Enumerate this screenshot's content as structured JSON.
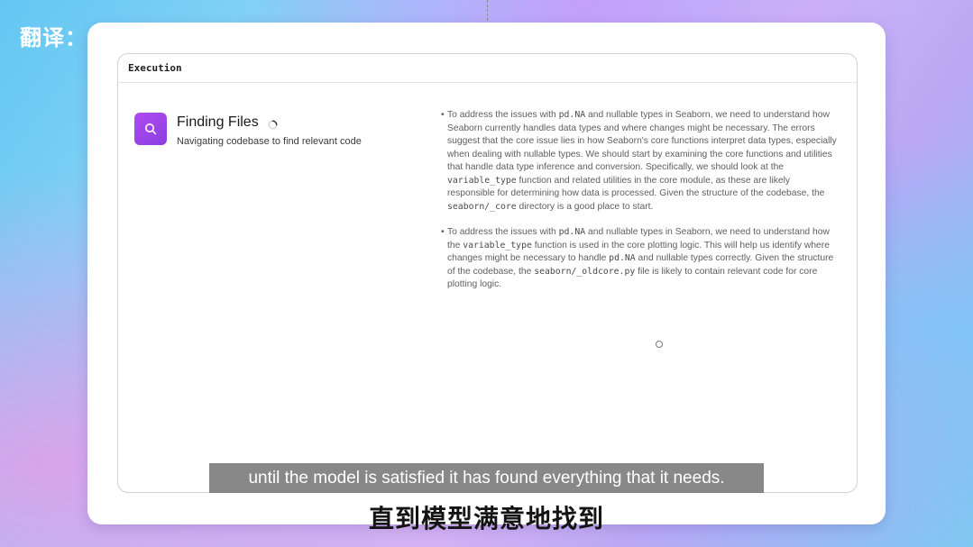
{
  "watermark": "翻译：",
  "panel": {
    "title": "Execution"
  },
  "step": {
    "icon": "search-icon",
    "title": "Finding Files",
    "status_icon": "loading-spinner-icon",
    "subtitle": "Navigating codebase to find relevant code"
  },
  "log": {
    "entries": [
      {
        "segments": [
          {
            "text": "To address the issues with ",
            "code": false
          },
          {
            "text": "pd.NA",
            "code": true
          },
          {
            "text": " and nullable types in Seaborn, we need to understand how Seaborn currently handles data types and where changes might be necessary. The errors suggest that the core issue lies in how Seaborn's core functions interpret data types, especially when dealing with nullable types. We should start by examining the core functions and utilities that handle data type inference and conversion. Specifically, we should look at the ",
            "code": false
          },
          {
            "text": "variable_type",
            "code": true
          },
          {
            "text": " function and related utilities in the core module, as these are likely responsible for determining how data is processed. Given the structure of the codebase, the ",
            "code": false
          },
          {
            "text": "seaborn/_core",
            "code": true
          },
          {
            "text": " directory is a good place to start.",
            "code": false
          }
        ]
      },
      {
        "segments": [
          {
            "text": "To address the issues with ",
            "code": false
          },
          {
            "text": "pd.NA",
            "code": true
          },
          {
            "text": " and nullable types in Seaborn, we need to understand how the ",
            "code": false
          },
          {
            "text": "variable_type",
            "code": true
          },
          {
            "text": " function is used in the core plotting logic. This will help us identify where changes might be necessary to handle ",
            "code": false
          },
          {
            "text": "pd.NA",
            "code": true
          },
          {
            "text": " and nullable types correctly. Given the structure of the codebase, the ",
            "code": false
          },
          {
            "text": "seaborn/_oldcore.py",
            "code": true
          },
          {
            "text": " file is likely to contain relevant code for core plotting logic.",
            "code": false
          }
        ]
      }
    ]
  },
  "captions": {
    "english": "until the model is satisfied it has found everything that it needs.",
    "chinese": "直到模型满意地找到"
  },
  "colors": {
    "icon_bg": "#9b45ea",
    "caption_bg": "#6e6e6e"
  }
}
